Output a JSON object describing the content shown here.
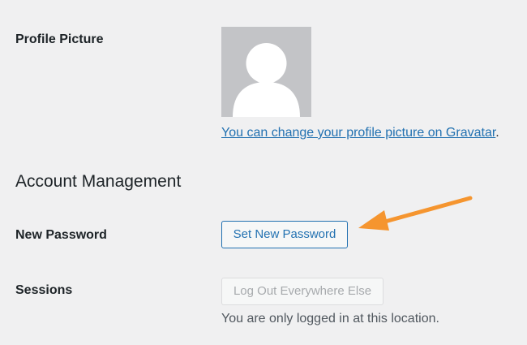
{
  "profile_picture": {
    "label": "Profile Picture",
    "gravatar_link_text": "You can change your profile picture on Gravatar",
    "gravatar_suffix": "."
  },
  "account_management": {
    "heading": "Account Management",
    "new_password": {
      "label": "New Password",
      "button_label": "Set New Password"
    },
    "sessions": {
      "label": "Sessions",
      "button_label": "Log Out Everywhere Else",
      "note": "You are only logged in at this location."
    }
  },
  "colors": {
    "background": "#f0f0f1",
    "link": "#2271b1",
    "annotation_arrow": "#f5952f",
    "avatar_bg": "#c3c4c7"
  },
  "icons": {
    "avatar": "default-avatar-silhouette-icon",
    "annotation": "annotation-arrow-icon"
  }
}
